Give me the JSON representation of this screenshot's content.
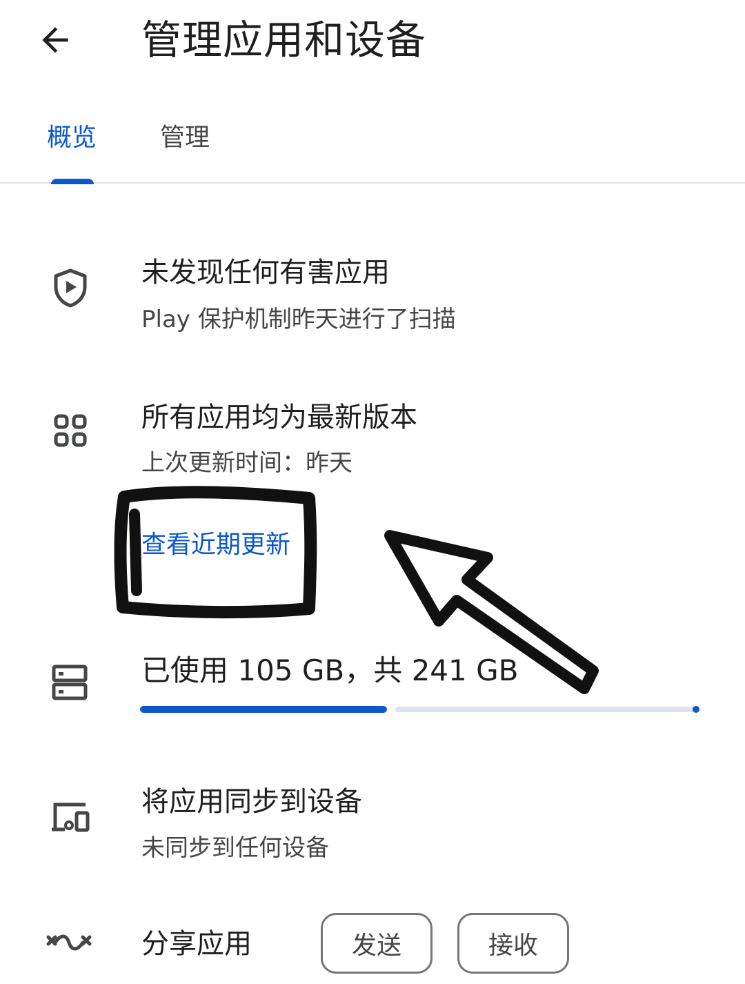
{
  "header": {
    "title": "管理应用和设备",
    "back_icon": "arrow-back-icon"
  },
  "tabs": [
    {
      "label": "概览",
      "selected": true
    },
    {
      "label": "管理",
      "selected": false
    }
  ],
  "protection": {
    "icon": "shield-play-icon",
    "title": "未发现任何有害应用",
    "subtitle": "Play 保护机制昨天进行了扫描"
  },
  "updates": {
    "icon": "apps-grid-icon",
    "title": "所有应用均为最新版本",
    "subtitle": "上次更新时间：昨天",
    "link": "查看近期更新"
  },
  "storage": {
    "icon": "storage-icon",
    "label": "已使用 105 GB，共 241 GB",
    "used_fraction": 0.436
  },
  "sync": {
    "icon": "devices-icon",
    "title": "将应用同步到设备",
    "subtitle": "未同步到任何设备"
  },
  "share": {
    "icon": "nearby-share-icon",
    "title": "分享应用",
    "send_label": "发送",
    "receive_label": "接收"
  },
  "colors": {
    "accent": "#0b57d0",
    "text_primary": "#1f1f1f",
    "text_secondary": "#444746",
    "annotation": "#111111"
  }
}
